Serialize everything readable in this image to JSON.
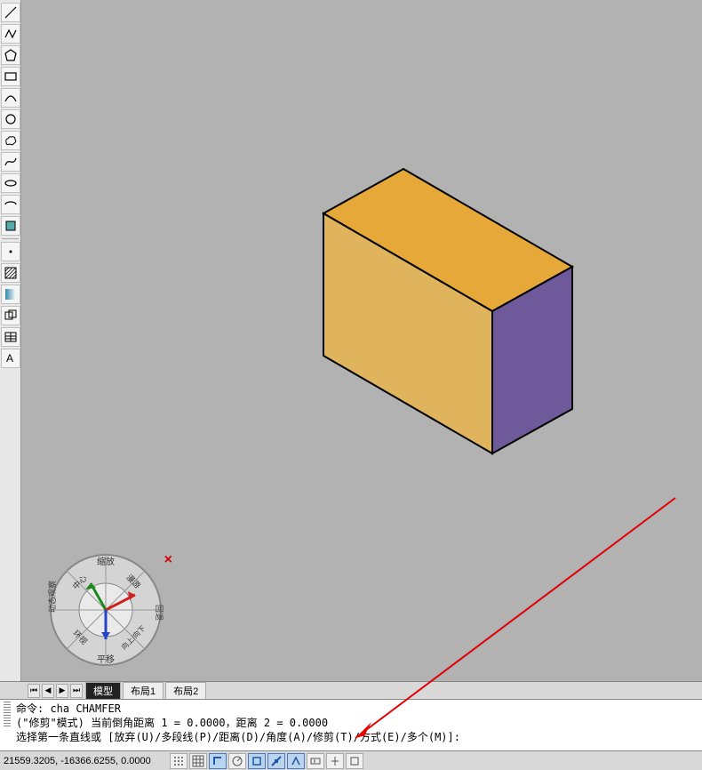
{
  "toolbar": {
    "tools": [
      {
        "name": "line-tool",
        "icon": "line"
      },
      {
        "name": "polyline-tool",
        "icon": "polyline"
      },
      {
        "name": "polygon-tool",
        "icon": "polygon"
      },
      {
        "name": "rectangle-tool",
        "icon": "rect"
      },
      {
        "name": "arc-tool",
        "icon": "arc"
      },
      {
        "name": "circle-tool",
        "icon": "circle"
      },
      {
        "name": "revcloud-tool",
        "icon": "cloud"
      },
      {
        "name": "spline-tool",
        "icon": "spline"
      },
      {
        "name": "ellipse-tool",
        "icon": "ellipse"
      },
      {
        "name": "ellipse-arc-tool",
        "icon": "ellipsearc"
      },
      {
        "name": "block-tool",
        "icon": "block"
      },
      {
        "name": "point-tool",
        "icon": "point"
      },
      {
        "name": "hatch-tool",
        "icon": "hatch"
      },
      {
        "name": "gradient-tool",
        "icon": "gradient"
      },
      {
        "name": "region-tool",
        "icon": "region"
      },
      {
        "name": "table-tool",
        "icon": "table"
      },
      {
        "name": "text-tool",
        "icon": "text"
      }
    ]
  },
  "viewcube_labels": {
    "top": "缩放",
    "left": "动态观察",
    "right": "回退",
    "bottom": "平移",
    "nw": "中心",
    "ne": "漫游",
    "se": "向上/向下",
    "sw": "环视"
  },
  "tabs": {
    "active": "模型",
    "items": [
      "模型",
      "布局1",
      "布局2"
    ]
  },
  "command": {
    "line1_prefix": "命令: ",
    "line1_cmd": "cha CHAMFER",
    "line2": "(\"修剪\"模式) 当前倒角距离 1 = 0.0000，距离 2 = 0.0000",
    "line3": "选择第一条直线或 [放弃(U)/多段线(P)/距离(D)/角度(A)/修剪(T)/方式(E)/多个(M)]:"
  },
  "status": {
    "coords": "21559.3205, -16366.6255, 0.0000",
    "buttons": [
      {
        "name": "snap-grid-dots",
        "on": false,
        "icon": "dots"
      },
      {
        "name": "grid-display",
        "on": false,
        "icon": "grid"
      },
      {
        "name": "ortho-mode",
        "on": true,
        "icon": "ortho"
      },
      {
        "name": "polar-tracking",
        "on": false,
        "icon": "polar"
      },
      {
        "name": "osnap",
        "on": true,
        "icon": "osnap"
      },
      {
        "name": "osnap-tracking",
        "on": true,
        "icon": "otrack"
      },
      {
        "name": "dynamic-ucs",
        "on": true,
        "icon": "ducs"
      },
      {
        "name": "dynamic-input",
        "on": false,
        "icon": "dyn"
      },
      {
        "name": "lineweight",
        "on": false,
        "icon": "lw"
      },
      {
        "name": "quick-props",
        "on": false,
        "icon": "qp"
      }
    ]
  },
  "chart_data": {
    "type": "3d-shape",
    "shape": "box",
    "view": "isometric",
    "faces": {
      "top": "#e6a838",
      "front_left": "#e0b45c",
      "front_right": "#6e5a9a"
    },
    "hidden_edges": "dashed"
  }
}
